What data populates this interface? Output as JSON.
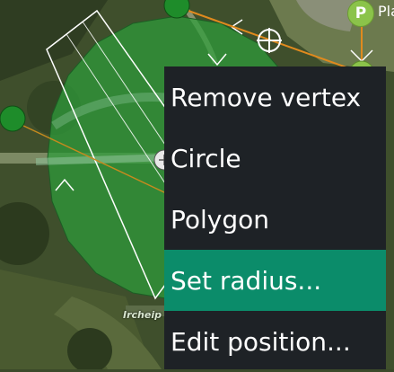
{
  "map": {
    "poi_marker": {
      "letter": "P",
      "label": "Pla"
    },
    "place_label": "Ircheip",
    "colors": {
      "geofence_fill": "#2e9c3a",
      "vertex": "#1e8c2a",
      "flight_path": "#e08a1e",
      "menu_background": "#1e2226",
      "menu_selected": "#0b8c6a"
    }
  },
  "context_menu": {
    "items": [
      {
        "label": "Remove vertex",
        "selected": false
      },
      {
        "label": "Circle",
        "selected": false
      },
      {
        "label": "Polygon",
        "selected": false
      },
      {
        "label": "Set radius...",
        "selected": true
      },
      {
        "label": "Edit position...",
        "selected": false
      }
    ]
  }
}
